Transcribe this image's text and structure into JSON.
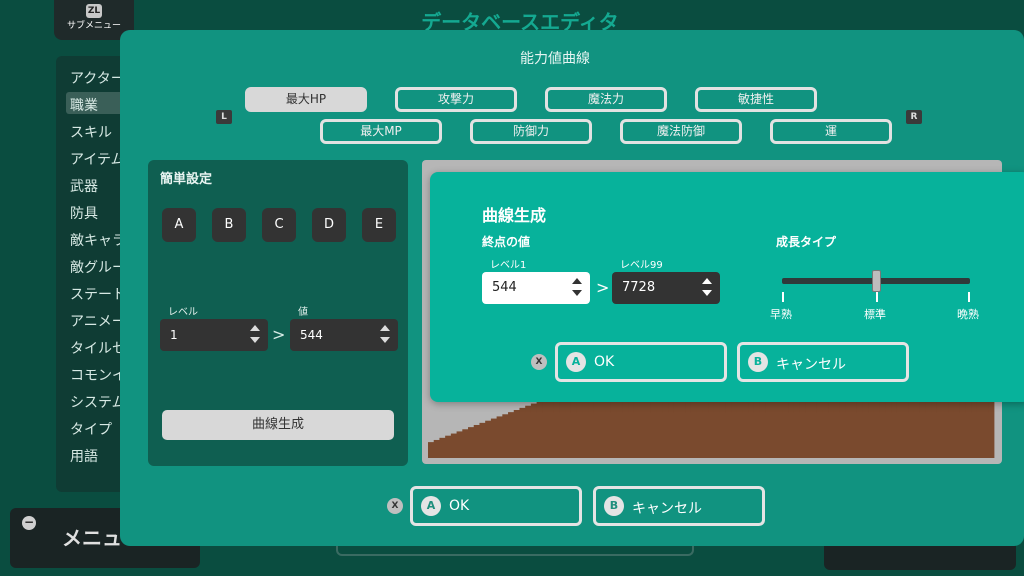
{
  "background": {
    "title": "データベースエディタ",
    "submenu": {
      "badge": "ZL",
      "label": "サブメニュー"
    },
    "sidebar": [
      {
        "label": "アクター"
      },
      {
        "label": "職業"
      },
      {
        "label": "スキル"
      },
      {
        "label": "アイテム"
      },
      {
        "label": "武器"
      },
      {
        "label": "防具"
      },
      {
        "label": "敵キャラ"
      },
      {
        "label": "敵グループ"
      },
      {
        "label": "ステート"
      },
      {
        "label": "アニメーション"
      },
      {
        "label": "タイルセット"
      },
      {
        "label": "コモンイベント"
      },
      {
        "label": "システム"
      },
      {
        "label": "タイプ"
      },
      {
        "label": "用語"
      }
    ],
    "menu": {
      "icon": "−",
      "label": "メニュー"
    }
  },
  "dialog": {
    "title": "能力値曲線",
    "left_shoulder": "L",
    "right_shoulder": "R",
    "tabs_row1": [
      "最大HP",
      "攻撃力",
      "魔法力",
      "敏捷性"
    ],
    "tabs_row2": [
      "最大MP",
      "防御力",
      "魔法防御",
      "運"
    ],
    "active_tab": "最大HP",
    "simple": {
      "title": "簡単設定",
      "presets": [
        "A",
        "B",
        "C",
        "D",
        "E"
      ],
      "level_label": "レベル",
      "value_label": "値",
      "level_value": "1",
      "value_value": "544",
      "separator": ">",
      "generate_label": "曲線生成"
    },
    "ok": {
      "key": "A",
      "label": "OK"
    },
    "cancel": {
      "key": "B",
      "label": "キャンセル"
    },
    "x_key": "X"
  },
  "popup": {
    "title": "曲線生成",
    "end_label": "終点の値",
    "level1_label": "レベル1",
    "level99_label": "レベル99",
    "level1_value": "544",
    "level99_value": "7728",
    "separator": ">",
    "growth_label": "成長タイプ",
    "growth_ticks": [
      "早熟",
      "標準",
      "晩熟"
    ],
    "growth_position": 0.5,
    "x_key": "X",
    "ok": {
      "key": "A",
      "label": "OK"
    },
    "cancel": {
      "key": "B",
      "label": "キャンセル"
    }
  },
  "colors": {
    "dialog_bg": "#119380",
    "popup_bg": "#07b29b",
    "curve_fill": "#7a4a2e"
  }
}
